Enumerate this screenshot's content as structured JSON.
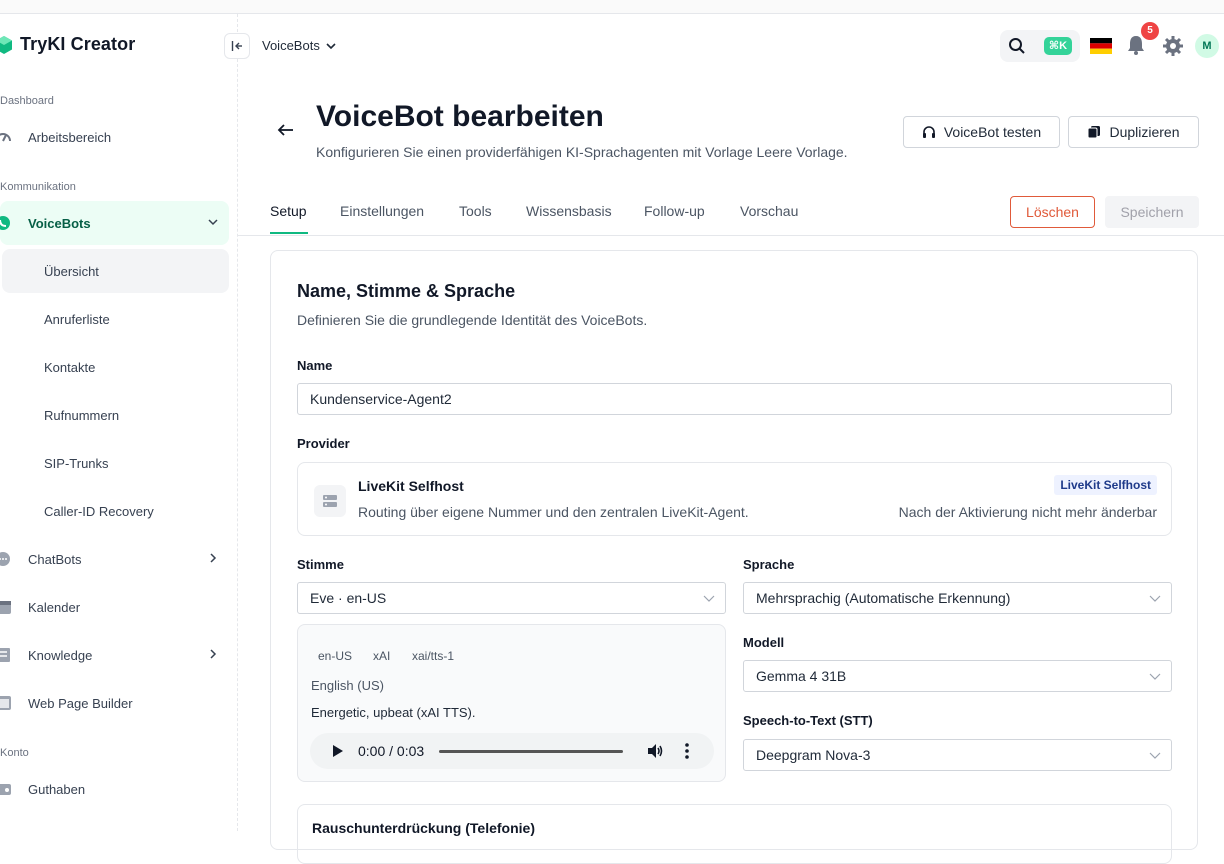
{
  "app": {
    "name": "TryKI Creator"
  },
  "sidebar": {
    "sections": [
      {
        "label": "Dashboard"
      },
      {
        "label": "Kommunikation"
      },
      {
        "label": "Konto"
      }
    ],
    "items": [
      {
        "label": "Arbeitsbereich"
      },
      {
        "label": "VoiceBots"
      },
      {
        "label": "ChatBots"
      },
      {
        "label": "Kalender"
      },
      {
        "label": "Knowledge"
      },
      {
        "label": "Web Page Builder"
      },
      {
        "label": "Guthaben"
      }
    ],
    "voicebots_sub": [
      {
        "label": "Übersicht"
      },
      {
        "label": "Anruferliste"
      },
      {
        "label": "Kontakte"
      },
      {
        "label": "Rufnummern"
      },
      {
        "label": "SIP-Trunks"
      },
      {
        "label": "Caller-ID Recovery"
      }
    ]
  },
  "topbar": {
    "breadcrumb": "VoiceBots",
    "shortcut": "⌘K",
    "notifications_count": "5",
    "avatar_initial": "M"
  },
  "header": {
    "title": "VoiceBot bearbeiten",
    "subtitle": "Konfigurieren Sie einen providerfähigen KI-Sprachagenten mit Vorlage Leere Vorlage.",
    "test_button": "VoiceBot testen",
    "duplicate_button": "Duplizieren"
  },
  "tabs": [
    {
      "label": "Setup"
    },
    {
      "label": "Einstellungen"
    },
    {
      "label": "Tools"
    },
    {
      "label": "Wissensbasis"
    },
    {
      "label": "Follow-up"
    },
    {
      "label": "Vorschau"
    }
  ],
  "actions": {
    "delete": "Löschen",
    "save": "Speichern"
  },
  "form": {
    "section_title": "Name, Stimme & Sprache",
    "section_desc": "Definieren Sie die grundlegende Identität des VoiceBots.",
    "name_label": "Name",
    "name_value": "Kundenservice-Agent2",
    "provider_label": "Provider",
    "provider": {
      "title": "LiveKit Selfhost",
      "desc": "Routing über eigene Nummer und den zentralen LiveKit-Agent.",
      "badge": "LiveKit Selfhost",
      "note": "Nach der Aktivierung nicht mehr änderbar"
    },
    "voice_label": "Stimme",
    "voice_value": "Eve · en-US",
    "language_label": "Sprache",
    "language_value": "Mehrsprachig (Automatische Erkennung)",
    "model_label": "Modell",
    "model_value": "Gemma 4 31B",
    "stt_label": "Speech-to-Text (STT)",
    "stt_value": "Deepgram Nova-3",
    "voice_info": {
      "chips": [
        "en-US",
        "xAI",
        "xai/tts-1"
      ],
      "language": "English (US)",
      "description": "Energetic, upbeat (xAI TTS).",
      "player_time": "0:00 / 0:03"
    },
    "noise_title": "Rauschunterdrückung (Telefonie)"
  },
  "colors": {
    "accent": "#10b981",
    "danger": "#e05a3a"
  }
}
